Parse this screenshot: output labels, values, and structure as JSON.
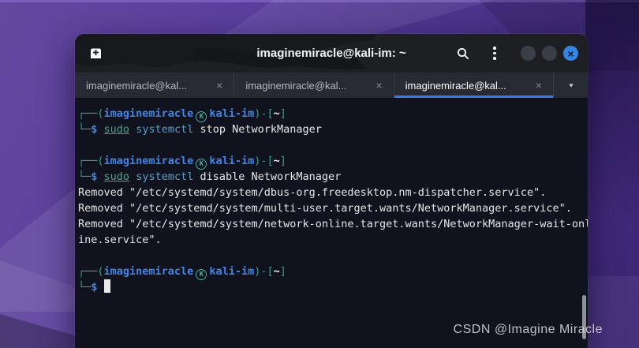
{
  "wallpaper": {
    "watermark": "CSDN @Imagine Miracle"
  },
  "window": {
    "title": "imaginemiracle@kali-im: ~",
    "controls": {
      "close_glyph": "×"
    },
    "tab_close_glyph": "×",
    "tab_dropdown_glyph": "▼",
    "tabs": [
      {
        "label": "imaginemiracle@kal...",
        "active": false
      },
      {
        "label": "imaginemiracle@kal...",
        "active": false
      },
      {
        "label": "imaginemiracle@kal...",
        "active": true
      }
    ]
  },
  "colors": {
    "accent_blue": "#3584e4",
    "active_tab_underline": "#377af0",
    "prompt_frame_green": "#35a08c",
    "prompt_user_blue": "#4086e8",
    "command_cyan": "#55a3cc",
    "terminal_bg": "#10121d"
  },
  "terminal": {
    "lines": [
      [
        {
          "t": "┌──(",
          "s": "frame"
        },
        {
          "t": "imaginemiracle",
          "s": "user"
        },
        {
          "t": "K",
          "s": "at"
        },
        {
          "t": "kali-im",
          "s": "user"
        },
        {
          "t": ")-[",
          "s": "frame"
        },
        {
          "t": "~",
          "s": "path"
        },
        {
          "t": "]",
          "s": "frame"
        }
      ],
      [
        {
          "t": "└─",
          "s": "frame"
        },
        {
          "t": "$",
          "s": "dollar"
        },
        {
          "t": " ",
          "s": "plain"
        },
        {
          "t": "sudo",
          "s": "sudo"
        },
        {
          "t": " ",
          "s": "plain"
        },
        {
          "t": "systemctl",
          "s": "cmd"
        },
        {
          "t": " stop NetworkManager",
          "s": "plain"
        }
      ],
      [],
      [
        {
          "t": "┌──(",
          "s": "frame"
        },
        {
          "t": "imaginemiracle",
          "s": "user"
        },
        {
          "t": "K",
          "s": "at"
        },
        {
          "t": "kali-im",
          "s": "user"
        },
        {
          "t": ")-[",
          "s": "frame"
        },
        {
          "t": "~",
          "s": "path"
        },
        {
          "t": "]",
          "s": "frame"
        }
      ],
      [
        {
          "t": "└─",
          "s": "frame"
        },
        {
          "t": "$",
          "s": "dollar"
        },
        {
          "t": " ",
          "s": "plain"
        },
        {
          "t": "sudo",
          "s": "sudo"
        },
        {
          "t": " ",
          "s": "plain"
        },
        {
          "t": "systemctl",
          "s": "cmd"
        },
        {
          "t": " disable NetworkManager",
          "s": "plain"
        }
      ],
      [
        {
          "t": "Removed \"/etc/systemd/system/dbus-org.freedesktop.nm-dispatcher.service\".",
          "s": "out"
        }
      ],
      [
        {
          "t": "Removed \"/etc/systemd/system/multi-user.target.wants/NetworkManager.service\".",
          "s": "out"
        }
      ],
      [
        {
          "t": "Removed \"/etc/systemd/system/network-online.target.wants/NetworkManager-wait-onl",
          "s": "out"
        }
      ],
      [
        {
          "t": "ine.service\".",
          "s": "out"
        }
      ],
      [],
      [
        {
          "t": "┌──(",
          "s": "frame"
        },
        {
          "t": "imaginemiracle",
          "s": "user"
        },
        {
          "t": "K",
          "s": "at"
        },
        {
          "t": "kali-im",
          "s": "user"
        },
        {
          "t": ")-[",
          "s": "frame"
        },
        {
          "t": "~",
          "s": "path"
        },
        {
          "t": "]",
          "s": "frame"
        }
      ],
      [
        {
          "t": "└─",
          "s": "frame"
        },
        {
          "t": "$",
          "s": "dollar"
        },
        {
          "t": " ",
          "s": "plain"
        },
        {
          "t": " ",
          "s": "cursor"
        }
      ]
    ]
  }
}
